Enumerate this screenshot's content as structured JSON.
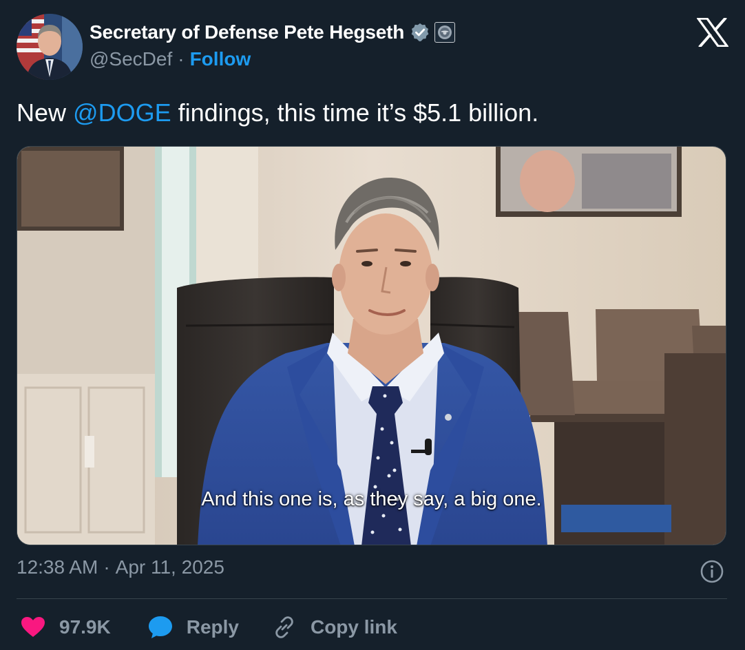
{
  "author": {
    "display_name": "Secretary of Defense Pete Hegseth",
    "handle": "@SecDef",
    "separator": "·",
    "follow_label": "Follow"
  },
  "tweet": {
    "text_before": "New ",
    "mention": "@DOGE",
    "text_after": " findings, this time it’s $5.1 billion."
  },
  "media": {
    "caption": "And this one is, as they say, a big one."
  },
  "meta": {
    "time": "12:38 AM",
    "separator": "·",
    "date": "Apr 11, 2025"
  },
  "actions": {
    "like_count": "97.9K",
    "reply_label": "Reply",
    "copy_link_label": "Copy link"
  },
  "colors": {
    "background": "#15202b",
    "accent": "#1d9bf0",
    "muted": "#8b98a5",
    "like": "#f91880"
  },
  "icons": [
    "verified-badge-icon",
    "government-affiliate-icon",
    "x-logo-icon",
    "info-icon",
    "heart-icon",
    "reply-bubble-icon",
    "link-icon"
  ]
}
